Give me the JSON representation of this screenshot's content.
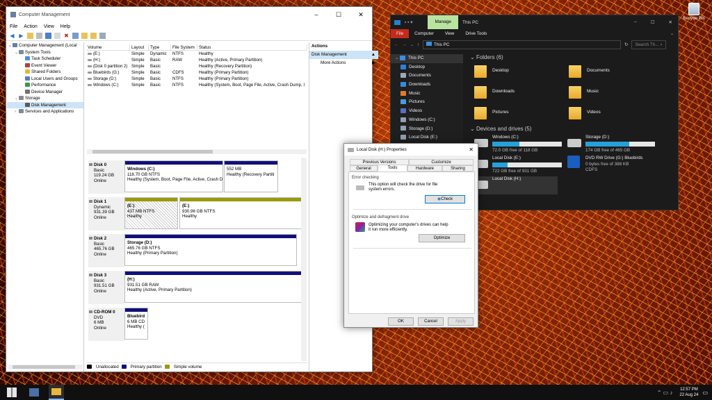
{
  "desktop": {
    "recycle_bin": "Recycle Bin"
  },
  "cm": {
    "title": "Computer Management",
    "menu": [
      "File",
      "Action",
      "View",
      "Help"
    ],
    "tree": [
      {
        "label": "Computer Management (Local",
        "indent": 0,
        "color": "#6a7fa0"
      },
      {
        "label": "System Tools",
        "indent": 1,
        "color": "#7a8aa0"
      },
      {
        "label": "Task Scheduler",
        "indent": 2,
        "color": "#4a8fd8"
      },
      {
        "label": "Event Viewer",
        "indent": 2,
        "color": "#b04040"
      },
      {
        "label": "Shared Folders",
        "indent": 2,
        "color": "#e0b840"
      },
      {
        "label": "Local Users and Groups",
        "indent": 2,
        "color": "#5a7ac0"
      },
      {
        "label": "Performance",
        "indent": 2,
        "color": "#3a9a3a"
      },
      {
        "label": "Device Manager",
        "indent": 2,
        "color": "#707070"
      },
      {
        "label": "Storage",
        "indent": 1,
        "color": "#8a8a8a"
      },
      {
        "label": "Disk Management",
        "indent": 2,
        "color": "#5a5a5a",
        "selected": true
      },
      {
        "label": "Services and Applications",
        "indent": 1,
        "color": "#7a8aa0"
      }
    ],
    "volume_headers": [
      "Volume",
      "Layout",
      "Type",
      "File System",
      "Status"
    ],
    "volumes": [
      [
        "(E:)",
        "Simple",
        "Dynamic",
        "NTFS",
        "Healthy"
      ],
      [
        "(H:)",
        "Simple",
        "Basic",
        "RAW",
        "Healthy (Active, Primary Partition)"
      ],
      [
        "(Disk 0 partition 2)",
        "Simple",
        "Basic",
        "",
        "Healthy (Recovery Partition)"
      ],
      [
        "Bluebirds (G:)",
        "Simple",
        "Basic",
        "CDFS",
        "Healthy (Primary Partition)"
      ],
      [
        "Storage (D:)",
        "Simple",
        "Basic",
        "NTFS",
        "Healthy (Primary Partition)"
      ],
      [
        "Windows (C:)",
        "Simple",
        "Basic",
        "NTFS",
        "Healthy (System, Boot, Page File, Active, Crash Dump, I"
      ]
    ],
    "disks": [
      {
        "name": "Disk 0",
        "lines": [
          "Basic",
          "119.24 GB",
          "Online"
        ],
        "parts": [
          {
            "l1": "Windows (C:)",
            "l2": "118.70 GB NTFS",
            "l3": "Healthy (System, Boot, Page File, Active, Crash D"
          },
          {
            "l1": "",
            "l2": "552 MB",
            "l3": "Healthy (Recovery Partiti"
          }
        ]
      },
      {
        "name": "Disk 1",
        "lines": [
          "Dynamic",
          "931.39 GB",
          "Online"
        ],
        "parts": [
          {
            "l1": "(E:)",
            "l2": "437 MB NTFS",
            "l3": "Healthy"
          },
          {
            "l1": "(E:)",
            "l2": "930.96 GB NTFS",
            "l3": "Healthy"
          }
        ]
      },
      {
        "name": "Disk 2",
        "lines": [
          "Basic",
          "465.76 GB",
          "Online"
        ],
        "parts": [
          {
            "l1": "Storage  (D:)",
            "l2": "465.76 GB NTFS",
            "l3": "Healthy (Primary Partition)"
          }
        ]
      },
      {
        "name": "Disk 3",
        "lines": [
          "Basic",
          "931.51 GB",
          "Online"
        ],
        "parts": [
          {
            "l1": "(H:)",
            "l2": "931.51 GB RAW",
            "l3": "Healthy (Active, Primary Partition)"
          }
        ]
      },
      {
        "name": "CD-ROM 0",
        "lines": [
          "DVD",
          "6 MB",
          "Online"
        ],
        "parts": [
          {
            "l1": "Bluebird",
            "l2": "6 MB CD",
            "l3": "Healthy ("
          }
        ]
      }
    ],
    "legend": [
      "Unallocated",
      "Primary partition",
      "Simple volume"
    ],
    "actions": {
      "header": "Actions",
      "selected": "Disk Management",
      "more": "More Actions"
    }
  },
  "explorer": {
    "manage_tab": "Manage",
    "title": "This PC",
    "ribbon": [
      "File",
      "Computer",
      "View",
      "Drive Tools"
    ],
    "address": "This PC",
    "search": "Search Th...",
    "nav": [
      "This PC",
      "Desktop",
      "Documents",
      "Downloads",
      "Music",
      "Pictures",
      "Videos",
      "Windows (C:)",
      "Storage (D:)",
      "Local Disk (E:)"
    ],
    "folders_header": "Folders (6)",
    "folders": [
      "Desktop",
      "Documents",
      "Downloads",
      "Music",
      "Pictures",
      "Videos"
    ],
    "drives_header": "Devices and drives (5)",
    "drives": [
      {
        "name": "Windows (C:)",
        "free": "72.0 GB free of 118 GB",
        "used": 0.39
      },
      {
        "name": "Storage (D:)",
        "free": "174 GB free of 465 GB",
        "used": 0.63
      },
      {
        "name": "Local Disk (E:)",
        "free": "722 GB free of 931 GB",
        "used": 0.22
      },
      {
        "name": "DVD RW Drive (G:) Bluebirds",
        "free": "0 bytes free of 388 KB",
        "sub": "CDFS"
      },
      {
        "name": "Local Disk (H:)",
        "free": ""
      }
    ]
  },
  "dialog": {
    "title": "Local Disk (H:) Properties",
    "tabs_row1": [
      "Previous Versions",
      "Customize"
    ],
    "tabs_row2": [
      "General",
      "Tools",
      "Hardware",
      "Sharing"
    ],
    "error_title": "Error checking",
    "error_text": "This option will check the drive for file system errors.",
    "check": "Check",
    "opt_title": "Optimize and defragment drive",
    "opt_text": "Optimizing your computer's drives can help it run more efficiently.",
    "optimize": "Optimize",
    "ok": "OK",
    "cancel": "Cancel",
    "apply": "Apply"
  },
  "taskbar": {
    "time": "12:57 PM",
    "date": "22 Aug 24"
  }
}
